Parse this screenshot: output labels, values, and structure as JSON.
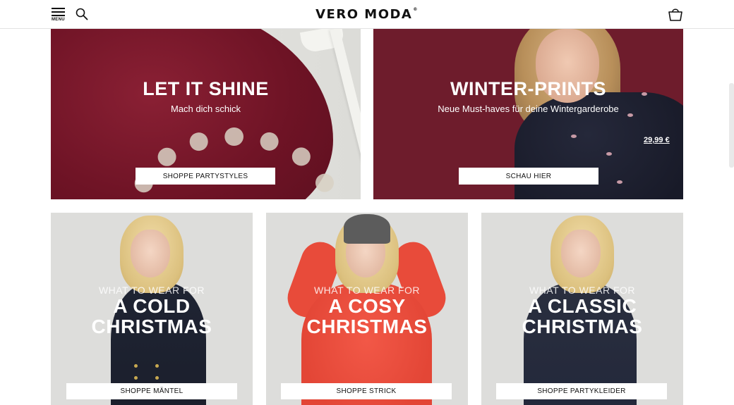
{
  "header": {
    "menu_label": "MENU",
    "logo_text": "VERO MODA",
    "logo_mark": "®",
    "icons": [
      "menu-icon",
      "search-icon",
      "shopping-bag-icon"
    ]
  },
  "banners": [
    {
      "title": "LET IT SHINE",
      "subtitle": "Mach dich schick",
      "cta": "SHOPPE PARTYSTYLES",
      "bg_color": "#6e1325"
    },
    {
      "title": "WINTER-PRINTS",
      "subtitle": "Neue Must-haves für deine Wintergarderobe",
      "price": "29,99 €",
      "cta": "SCHAU HIER",
      "bg_color": "#6e1c2c"
    }
  ],
  "tiles": [
    {
      "kicker": "WHAT TO WEAR FOR",
      "line1": "A COLD",
      "line2": "CHRISTMAS",
      "cta": "SHOPPE MÄNTEL"
    },
    {
      "kicker": "WHAT TO WEAR FOR",
      "line1": "A COSY",
      "line2": "CHRISTMAS",
      "cta": "SHOPPE STRICK"
    },
    {
      "kicker": "WHAT TO WEAR FOR",
      "line1": "A CLASSIC",
      "line2": "CHRISTMAS",
      "cta": "SHOPPE PARTYKLEIDER"
    }
  ],
  "colors": {
    "accent_burgundy": "#6e1325",
    "cta_background": "#ffffff",
    "text_dark": "#111111"
  }
}
